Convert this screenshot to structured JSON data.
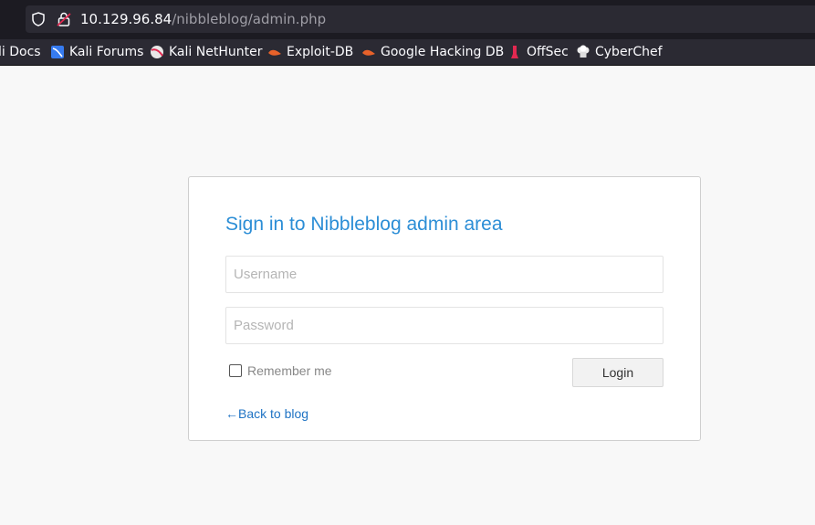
{
  "browser": {
    "url_host": "10.129.96.84",
    "url_path": "/nibbleblog/admin.php",
    "bookmarks": [
      {
        "label": "li Docs",
        "icon": "kali-docs-icon"
      },
      {
        "label": "Kali Forums",
        "icon": "kali-forums-icon"
      },
      {
        "label": "Kali NetHunter",
        "icon": "kali-nethunter-icon"
      },
      {
        "label": "Exploit-DB",
        "icon": "exploit-db-icon"
      },
      {
        "label": "Google Hacking DB",
        "icon": "google-hacking-db-icon"
      },
      {
        "label": "OffSec",
        "icon": "offsec-icon"
      },
      {
        "label": "CyberChef",
        "icon": "cyberchef-icon"
      }
    ]
  },
  "login": {
    "title": "Sign in to Nibbleblog admin area",
    "username_placeholder": "Username",
    "password_placeholder": "Password",
    "remember_label": "Remember me",
    "login_label": "Login",
    "back_label": "←Back to blog"
  },
  "colors": {
    "title": "#2c8ed6",
    "link": "#1f73c4",
    "chrome_dark": "#1c1b22",
    "chrome": "#2b2a33"
  }
}
